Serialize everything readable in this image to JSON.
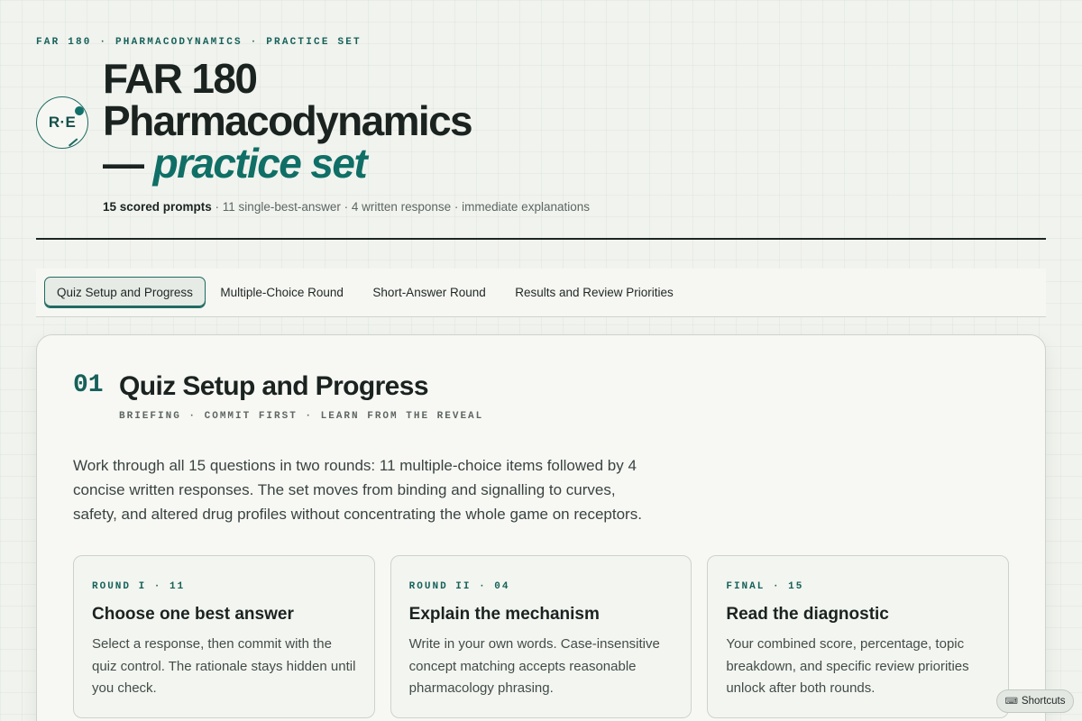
{
  "header": {
    "kicker": "FAR 180 · PHARMACODYNAMICS · PRACTICE SET",
    "logo_text": "R·E",
    "title_line1": "FAR 180",
    "title_line2": "Pharmacodynamics",
    "title_dash": "— ",
    "title_accent": "practice set",
    "meta_strong": "15 scored prompts",
    "meta_rest": " · 11 single-best-answer · 4 written response · immediate explanations"
  },
  "tabs": [
    {
      "label": "Quiz Setup and Progress",
      "active": true
    },
    {
      "label": "Multiple-Choice Round",
      "active": false
    },
    {
      "label": "Short-Answer Round",
      "active": false
    },
    {
      "label": "Results and Review Priorities",
      "active": false
    }
  ],
  "section": {
    "number": "01",
    "title": "Quiz Setup and Progress",
    "subtitle": "BRIEFING · COMMIT FIRST · LEARN FROM THE REVEAL",
    "intro": "Work through all 15 questions in two rounds: 11 multiple-choice items followed by 4 concise written responses. The set moves from binding and signalling to curves, safety, and altered drug profiles without concentrating the whole game on receptors.",
    "cards": [
      {
        "kicker": "ROUND I · 11",
        "title": "Choose one best answer",
        "body": "Select a response, then commit with the quiz control. The rationale stays hidden until you check."
      },
      {
        "kicker": "ROUND II · 04",
        "title": "Explain the mechanism",
        "body": "Write in your own words. Case-insensitive concept matching accepts reasonable pharmacology phrasing."
      },
      {
        "kicker": "FINAL · 15",
        "title": "Read the diagnostic",
        "body": "Your combined score, percentage, topic breakdown, and specific review priorities unlock after both rounds."
      }
    ]
  },
  "shortcuts": {
    "icon": "keyboard-icon",
    "glyph": "⌨",
    "label": "Shortcuts"
  },
  "colors": {
    "accent": "#0f6f66",
    "ink": "#1b2321",
    "background": "#f1f3ee"
  }
}
